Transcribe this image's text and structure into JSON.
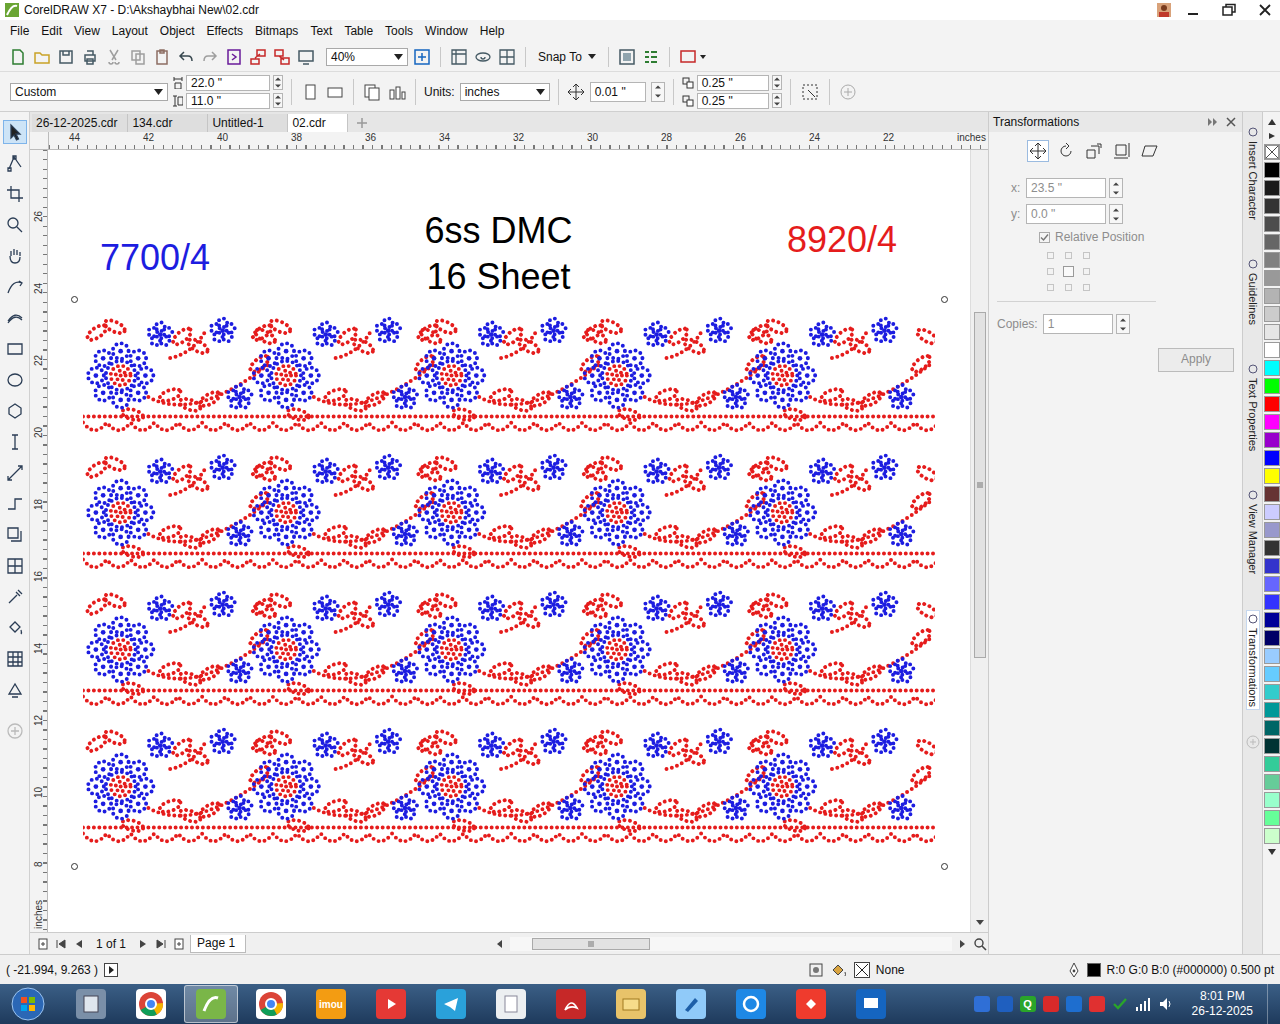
{
  "window": {
    "title": "CorelDRAW X7 - D:\\Akshaybhai New\\02.cdr"
  },
  "menu": [
    "File",
    "Edit",
    "View",
    "Layout",
    "Object",
    "Effects",
    "Bitmaps",
    "Text",
    "Table",
    "Tools",
    "Window",
    "Help"
  ],
  "toolbar": {
    "zoom": "40%",
    "snap": "Snap To"
  },
  "property_bar": {
    "preset": "Custom",
    "width": "22.0 \"",
    "height": "11.0 \"",
    "units_label": "Units:",
    "units": "inches",
    "nudge": "0.01 \"",
    "duplicate_x": "0.25 \"",
    "duplicate_y": "0.25 \""
  },
  "tools": [
    {
      "kind": "pick",
      "selected": true
    },
    {
      "kind": "shape",
      "selected": false
    },
    {
      "kind": "crop",
      "selected": false
    },
    {
      "kind": "zoom",
      "selected": false
    },
    {
      "kind": "pan",
      "selected": false
    },
    {
      "kind": "curve",
      "selected": false
    },
    {
      "kind": "artistic",
      "selected": false
    },
    {
      "kind": "rectangle",
      "selected": false
    },
    {
      "kind": "ellipse",
      "selected": false
    },
    {
      "kind": "polygon",
      "selected": false
    },
    {
      "kind": "text",
      "selected": false
    },
    {
      "kind": "dimension",
      "selected": false
    },
    {
      "kind": "connector",
      "selected": false
    },
    {
      "kind": "shadow",
      "selected": false
    },
    {
      "kind": "transparency",
      "selected": false
    },
    {
      "kind": "eyedropper",
      "selected": false
    },
    {
      "kind": "fill",
      "selected": false
    },
    {
      "kind": "mesh",
      "selected": false
    },
    {
      "kind": "smartfill",
      "selected": false
    },
    {
      "kind": "add",
      "selected": false
    }
  ],
  "doc_tabs": [
    {
      "label": "26-12-2025.cdr",
      "selected": false
    },
    {
      "label": "134.cdr",
      "selected": false
    },
    {
      "label": "Untitled-1",
      "selected": false
    },
    {
      "label": "02.cdr",
      "selected": true
    }
  ],
  "rulers": {
    "top": [
      "44",
      "42",
      "40",
      "38",
      "36",
      "34",
      "32",
      "30",
      "28",
      "26",
      "24",
      "22"
    ],
    "left": [
      "26",
      "24",
      "22",
      "20",
      "18",
      "16",
      "14",
      "12",
      "10",
      "8"
    ],
    "unit": "inches"
  },
  "canvas": {
    "labels": [
      {
        "text": "7700/4",
        "color": "#1d1de0"
      },
      {
        "text": "8920/4",
        "color": "#e51c1c"
      }
    ],
    "title": [
      "6ss DMC",
      "16 Sheet"
    ]
  },
  "page_nav": {
    "count": "1 of 1",
    "page": "Page 1"
  },
  "docker": {
    "title": "Transformations",
    "modes": [
      {
        "kind": "position",
        "selected": true
      },
      {
        "kind": "rotate",
        "selected": false
      },
      {
        "kind": "scale",
        "selected": false
      },
      {
        "kind": "size",
        "selected": false
      },
      {
        "kind": "skew",
        "selected": false
      }
    ],
    "x": {
      "label": "x:",
      "value": "23.5 \"",
      "disabled": true
    },
    "y": {
      "label": "y:",
      "value": "0.0 \"",
      "disabled": true
    },
    "relative_position": {
      "label": "Relative Position",
      "checked": true,
      "disabled": true
    },
    "anchors": [
      {
        "selected": false
      },
      {
        "selected": false
      },
      {
        "selected": false
      },
      {
        "selected": false
      },
      {
        "selected": true
      },
      {
        "selected": false
      },
      {
        "selected": false
      },
      {
        "selected": false
      },
      {
        "selected": false
      }
    ],
    "copies": {
      "label": "Copies:",
      "value": "1",
      "disabled": true
    },
    "apply": {
      "label": "Apply",
      "disabled": true
    }
  },
  "side_tabs": [
    {
      "label": "Insert Character",
      "selected": false
    },
    {
      "label": "Guidelines",
      "selected": false
    },
    {
      "label": "Text Properties",
      "selected": false
    },
    {
      "label": "View Manager",
      "selected": false
    },
    {
      "label": "Transformations",
      "selected": true
    }
  ],
  "palette": [
    {
      "kind": "none"
    },
    {
      "kind": "swatch",
      "color": "#000000"
    },
    {
      "kind": "swatch",
      "color": "#1a1a1a"
    },
    {
      "kind": "swatch",
      "color": "#333333"
    },
    {
      "kind": "swatch",
      "color": "#4d4d4d"
    },
    {
      "kind": "swatch",
      "color": "#666666"
    },
    {
      "kind": "swatch",
      "color": "#808080"
    },
    {
      "kind": "swatch",
      "color": "#999999"
    },
    {
      "kind": "swatch",
      "color": "#b3b3b3"
    },
    {
      "kind": "swatch",
      "color": "#cccccc"
    },
    {
      "kind": "swatch",
      "color": "#e6e6e6"
    },
    {
      "kind": "swatch",
      "color": "#ffffff"
    },
    {
      "kind": "swatch",
      "color": "#00ffff"
    },
    {
      "kind": "swatch",
      "color": "#00ff00"
    },
    {
      "kind": "swatch",
      "color": "#ff0000"
    },
    {
      "kind": "swatch",
      "color": "#ff00ff"
    },
    {
      "kind": "swatch",
      "color": "#9900cc"
    },
    {
      "kind": "swatch",
      "color": "#0000ff"
    },
    {
      "kind": "swatch",
      "color": "#ffff00"
    },
    {
      "kind": "swatch",
      "color": "#663333"
    },
    {
      "kind": "swatch",
      "color": "#ccccff"
    },
    {
      "kind": "swatch",
      "color": "#9999cc"
    },
    {
      "kind": "swatch",
      "color": "#333333"
    },
    {
      "kind": "swatch",
      "color": "#3333cc"
    },
    {
      "kind": "swatch",
      "color": "#6666ff"
    },
    {
      "kind": "swatch",
      "color": "#3333ff"
    },
    {
      "kind": "swatch",
      "color": "#000099"
    },
    {
      "kind": "swatch",
      "color": "#000066"
    },
    {
      "kind": "swatch",
      "color": "#99ccff"
    },
    {
      "kind": "swatch",
      "color": "#66ccff"
    },
    {
      "kind": "swatch",
      "color": "#33cccc"
    },
    {
      "kind": "swatch",
      "color": "#009999"
    },
    {
      "kind": "swatch",
      "color": "#006666"
    },
    {
      "kind": "swatch",
      "color": "#003333"
    },
    {
      "kind": "swatch",
      "color": "#33cc99"
    },
    {
      "kind": "swatch",
      "color": "#66cc99"
    },
    {
      "kind": "swatch",
      "color": "#99ffcc"
    },
    {
      "kind": "swatch",
      "color": "#66ff99"
    },
    {
      "kind": "swatch",
      "color": "#ccffcc"
    }
  ],
  "status_bar": {
    "coords": "( -21.994, 9.263 )",
    "fill": "None",
    "outline": "R:0 G:0 B:0 (#000000) 0.500 pt",
    "outline_color": "#000000"
  },
  "taskbar": {
    "apps": [
      {
        "kind": "calculator",
        "active": false
      },
      {
        "kind": "chrome",
        "active": false
      },
      {
        "kind": "coreldraw",
        "active": true
      },
      {
        "kind": "chrome",
        "active": false
      },
      {
        "kind": "imou",
        "active": false,
        "label": "imou"
      },
      {
        "kind": "media",
        "active": false
      },
      {
        "kind": "telegram",
        "active": false
      },
      {
        "kind": "document",
        "active": false
      },
      {
        "kind": "acrobat",
        "active": false
      },
      {
        "kind": "explorer",
        "active": false
      },
      {
        "kind": "capture",
        "active": false
      },
      {
        "kind": "ie",
        "active": false
      },
      {
        "kind": "anydesk",
        "active": false
      },
      {
        "kind": "remote",
        "active": false
      }
    ],
    "tray": [
      {
        "kind": "badge",
        "color": "#2f6fd6"
      },
      {
        "kind": "badge",
        "color": "#1f5fbf"
      },
      {
        "kind": "badge",
        "color": "#2aa52a",
        "label": "Q"
      },
      {
        "kind": "badge",
        "color": "#d82a2a"
      },
      {
        "kind": "badge",
        "color": "#1e6ecf"
      },
      {
        "kind": "badge",
        "color": "#e03030"
      },
      {
        "kind": "check",
        "color": "#2aa52a"
      },
      {
        "kind": "network"
      },
      {
        "kind": "volume"
      }
    ],
    "time": "8:01 PM",
    "date": "26-12-2025"
  }
}
